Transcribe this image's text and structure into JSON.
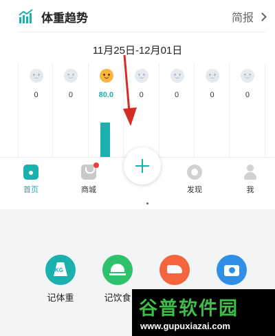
{
  "header": {
    "title": "体重趋势",
    "report_label": "简报"
  },
  "date_range": "11月25日-12月01日",
  "week": {
    "days": [
      {
        "value": "0",
        "active": false
      },
      {
        "value": "0",
        "active": false
      },
      {
        "value": "80.0",
        "active": true
      },
      {
        "value": "0",
        "active": false
      },
      {
        "value": "0",
        "active": false
      },
      {
        "value": "0",
        "active": false
      },
      {
        "value": "0",
        "active": false
      }
    ]
  },
  "nav": {
    "home": "首页",
    "mall": "商城",
    "discover": "发现",
    "me": "我"
  },
  "actions": {
    "weight": "记体重",
    "food": "记饮食",
    "weight_icon_text": "KG"
  },
  "watermark": {
    "text": "谷普软件园",
    "url": "www.gupuxiazai.com"
  },
  "colors": {
    "accent": "#19b0ad",
    "food": "#2ec16b",
    "run": "#f5653d",
    "camera": "#2f8fe6"
  }
}
